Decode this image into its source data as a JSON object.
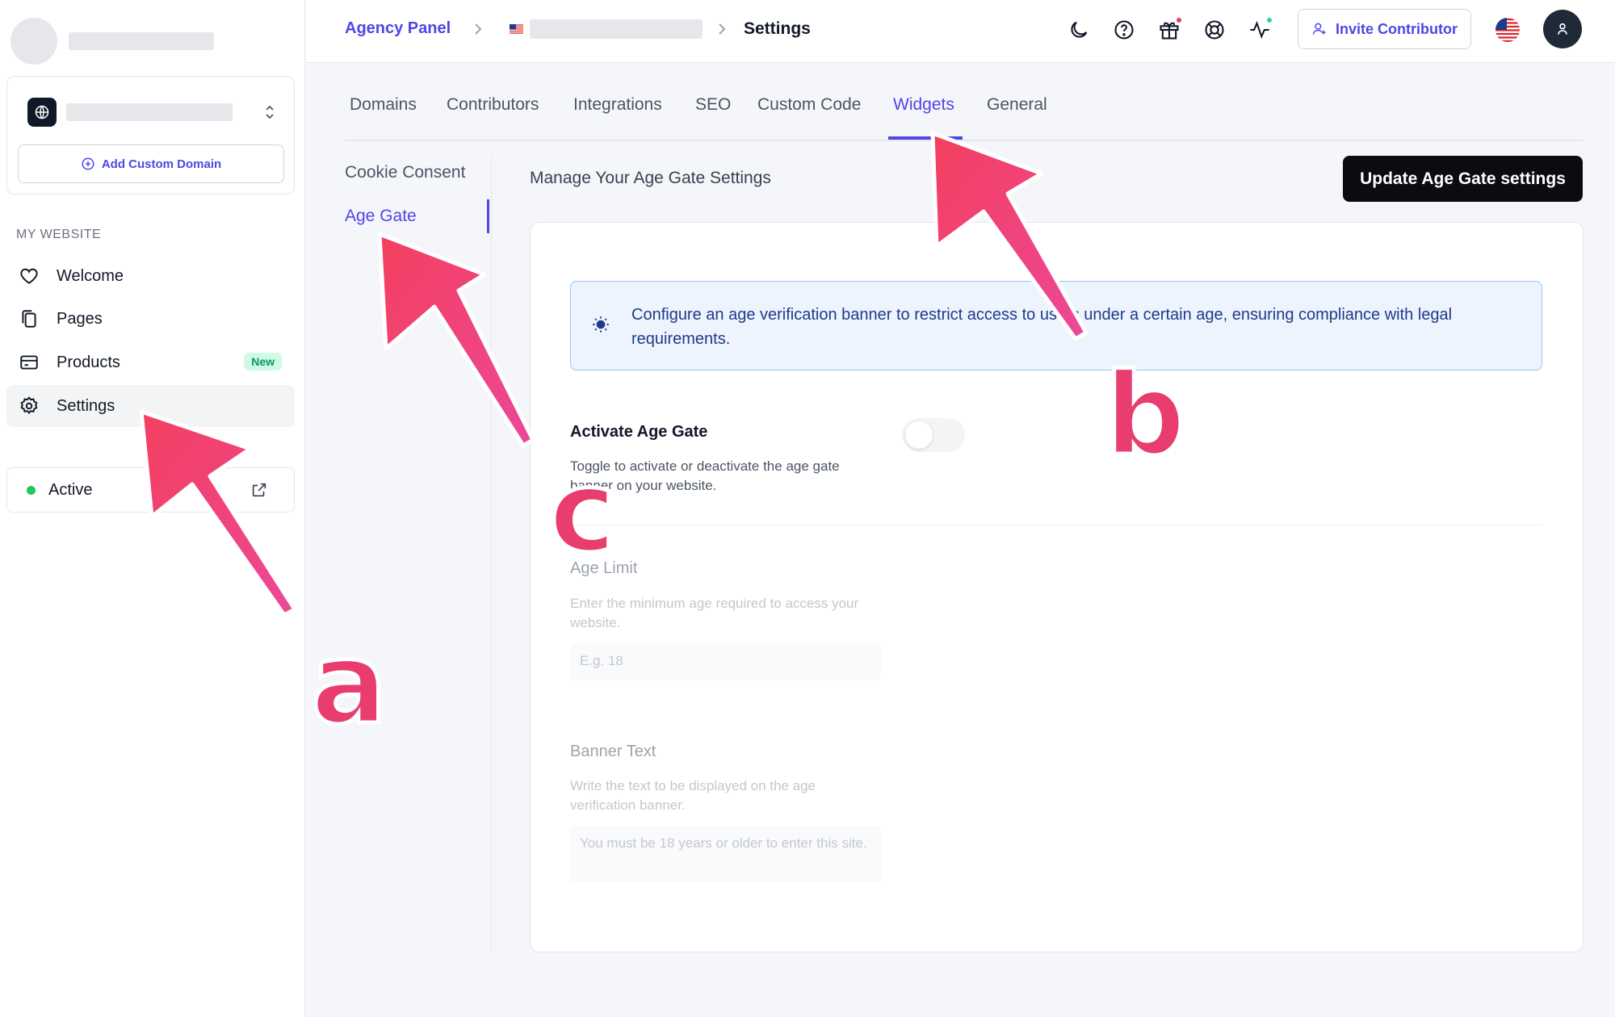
{
  "sidebar": {
    "add_domain_label": "Add Custom Domain",
    "section_label": "MY WEBSITE",
    "items": [
      {
        "label": "Welcome",
        "icon": "heart-icon"
      },
      {
        "label": "Pages",
        "icon": "pages-icon"
      },
      {
        "label": "Products",
        "icon": "credit-card-icon",
        "badge": "New"
      },
      {
        "label": "Settings",
        "icon": "gear-icon",
        "active": true
      }
    ],
    "status": "Active"
  },
  "header": {
    "breadcrumb_root": "Agency Panel",
    "breadcrumb_current": "Settings",
    "invite_label": "Invite Contributor",
    "icons": [
      "moon-icon",
      "help-icon",
      "gift-icon",
      "support-icon",
      "activity-icon"
    ],
    "colors": {
      "gift_dot": "#e93d6f",
      "activity_dot": "#34d399"
    }
  },
  "tabs": [
    {
      "label": "Domains"
    },
    {
      "label": "Contributors"
    },
    {
      "label": "Integrations"
    },
    {
      "label": "SEO"
    },
    {
      "label": "Custom Code"
    },
    {
      "label": "Widgets",
      "active": true
    },
    {
      "label": "General"
    }
  ],
  "subnav": [
    {
      "label": "Cookie Consent"
    },
    {
      "label": "Age Gate",
      "active": true
    }
  ],
  "content": {
    "title": "Manage Your Age Gate Settings",
    "update_button": "Update Age Gate settings",
    "info_text": "Configure an age verification banner to restrict access to users under a certain age, ensuring compliance with legal requirements.",
    "activate": {
      "title": "Activate Age Gate",
      "desc": "Toggle to activate or deactivate the age gate banner on your website.",
      "enabled": false
    },
    "age_limit": {
      "title": "Age Limit",
      "desc": "Enter the minimum age required to access your website.",
      "placeholder": "E.g. 18"
    },
    "banner_text": {
      "title": "Banner Text",
      "desc": "Write the text to be displayed on the age verification banner.",
      "placeholder": "You must be 18 years or older to enter this site."
    }
  },
  "annotations": {
    "letters": [
      "a",
      "b",
      "c"
    ],
    "color": "#e93d6f"
  }
}
